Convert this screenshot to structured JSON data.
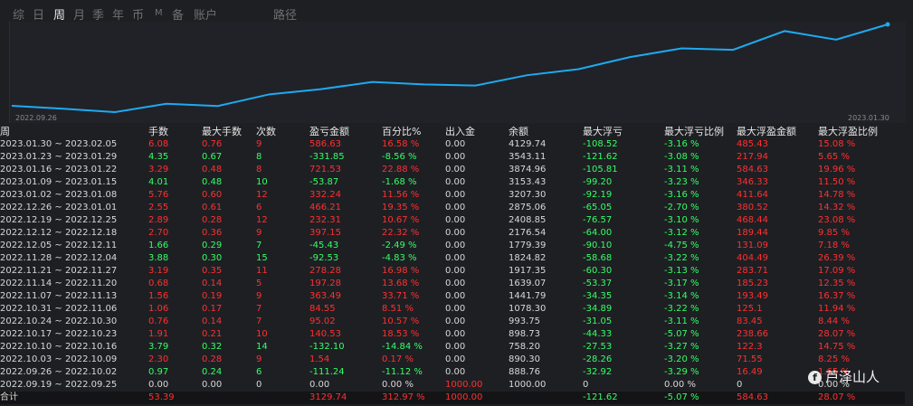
{
  "tabs": [
    "综",
    "日",
    "周",
    "月",
    "季",
    "年",
    "币",
    "M",
    "备",
    "账户",
    "路径"
  ],
  "active_tab": "周",
  "chart_data": {
    "type": "line",
    "x_start_label": "2022.09.26",
    "x_end_label": "2023.01.30",
    "y_values": [
      1000,
      888.76,
      758.2,
      1078.3,
      993.75,
      1441.79,
      1639.07,
      1917.35,
      1824.82,
      1779.39,
      2176.54,
      2408.85,
      2875.06,
      3207.3,
      3153.43,
      3874.96,
      3543.11,
      4129.74
    ],
    "color": "#1eaaf1"
  },
  "table": {
    "headers": [
      "周",
      "手数",
      "最大手数",
      "次数",
      "盈亏金额",
      "百分比%",
      "出入金",
      "余额",
      "最大浮亏",
      "最大浮亏比例",
      "最大浮盈金额",
      "最大浮盈比例"
    ],
    "rows": [
      [
        "2023.01.30 ~ 2023.02.05",
        "6.08",
        "0.76",
        "9",
        "586.63",
        "16.58 %",
        "0.00",
        "4129.74",
        "-108.52",
        "-3.16 %",
        "485.43",
        "15.08 %"
      ],
      [
        "2023.01.23 ~ 2023.01.29",
        "4.35",
        "0.67",
        "8",
        "-331.85",
        "-8.56 %",
        "0.00",
        "3543.11",
        "-121.62",
        "-3.08 %",
        "217.94",
        "5.65 %"
      ],
      [
        "2023.01.16 ~ 2023.01.22",
        "3.29",
        "0.48",
        "8",
        "721.53",
        "22.88 %",
        "0.00",
        "3874.96",
        "-105.81",
        "-3.11 %",
        "584.63",
        "19.96 %"
      ],
      [
        "2023.01.09 ~ 2023.01.15",
        "4.01",
        "0.48",
        "10",
        "-53.87",
        "-1.68 %",
        "0.00",
        "3153.43",
        "-99.20",
        "-3.23 %",
        "346.33",
        "11.50 %"
      ],
      [
        "2023.01.02 ~ 2023.01.08",
        "5.76",
        "0.60",
        "12",
        "332.24",
        "11.56 %",
        "0.00",
        "3207.30",
        "-92.19",
        "-3.16 %",
        "411.64",
        "14.78 %"
      ],
      [
        "2022.12.26 ~ 2023.01.01",
        "2.55",
        "0.61",
        "6",
        "466.21",
        "19.35 %",
        "0.00",
        "2875.06",
        "-65.05",
        "-2.70 %",
        "380.52",
        "14.32 %"
      ],
      [
        "2022.12.19 ~ 2022.12.25",
        "2.89",
        "0.28",
        "12",
        "232.31",
        "10.67 %",
        "0.00",
        "2408.85",
        "-76.57",
        "-3.10 %",
        "468.44",
        "23.08 %"
      ],
      [
        "2022.12.12 ~ 2022.12.18",
        "2.70",
        "0.36",
        "9",
        "397.15",
        "22.32 %",
        "0.00",
        "2176.54",
        "-64.00",
        "-3.12 %",
        "189.44",
        "9.85 %"
      ],
      [
        "2022.12.05 ~ 2022.12.11",
        "1.66",
        "0.29",
        "7",
        "-45.43",
        "-2.49 %",
        "0.00",
        "1779.39",
        "-90.10",
        "-4.75 %",
        "131.09",
        "7.18 %"
      ],
      [
        "2022.11.28 ~ 2022.12.04",
        "3.88",
        "0.30",
        "15",
        "-92.53",
        "-4.83 %",
        "0.00",
        "1824.82",
        "-58.68",
        "-3.22 %",
        "404.49",
        "26.39 %"
      ],
      [
        "2022.11.21 ~ 2022.11.27",
        "3.19",
        "0.35",
        "11",
        "278.28",
        "16.98 %",
        "0.00",
        "1917.35",
        "-60.30",
        "-3.13 %",
        "283.71",
        "17.09 %"
      ],
      [
        "2022.11.14 ~ 2022.11.20",
        "0.68",
        "0.14",
        "5",
        "197.28",
        "13.68 %",
        "0.00",
        "1639.07",
        "-53.37",
        "-3.17 %",
        "185.23",
        "12.35 %"
      ],
      [
        "2022.11.07 ~ 2022.11.13",
        "1.56",
        "0.19",
        "9",
        "363.49",
        "33.71 %",
        "0.00",
        "1441.79",
        "-34.35",
        "-3.14 %",
        "193.49",
        "16.37 %"
      ],
      [
        "2022.10.31 ~ 2022.11.06",
        "1.06",
        "0.17",
        "7",
        "84.55",
        "8.51 %",
        "0.00",
        "1078.30",
        "-34.89",
        "-3.22 %",
        "125.1",
        "11.94 %"
      ],
      [
        "2022.10.24 ~ 2022.10.30",
        "0.76",
        "0.14",
        "7",
        "95.02",
        "10.57 %",
        "0.00",
        "993.75",
        "-31.05",
        "-3.11 %",
        "83.45",
        "8.44 %"
      ],
      [
        "2022.10.17 ~ 2022.10.23",
        "1.91",
        "0.21",
        "10",
        "140.53",
        "18.53 %",
        "0.00",
        "898.73",
        "-44.33",
        "-5.07 %",
        "238.66",
        "28.07 %"
      ],
      [
        "2022.10.10 ~ 2022.10.16",
        "3.79",
        "0.32",
        "14",
        "-132.10",
        "-14.84 %",
        "0.00",
        "758.20",
        "-27.53",
        "-3.27 %",
        "122.3",
        "14.75 %"
      ],
      [
        "2022.10.03 ~ 2022.10.09",
        "2.30",
        "0.28",
        "9",
        "1.54",
        "0.17 %",
        "0.00",
        "890.30",
        "-28.26",
        "-3.20 %",
        "71.55",
        "8.25 %"
      ],
      [
        "2022.09.26 ~ 2022.10.02",
        "0.97",
        "0.24",
        "6",
        "-111.24",
        "-11.12 %",
        "0.00",
        "888.76",
        "-32.92",
        "-3.29 %",
        "16.49",
        "1.65 %"
      ],
      [
        "2022.09.19 ~ 2022.09.25",
        "0.00",
        "0.00",
        "0",
        "0.00",
        "0.00 %",
        "1000.00",
        "1000.00",
        "0",
        "0.00 %",
        "0",
        "0.00 %"
      ]
    ],
    "total": [
      "合计",
      "53.39",
      "",
      "",
      "3129.74",
      "312.97 %",
      "1000.00",
      "",
      "-121.62",
      "-5.07 %",
      "584.63",
      "28.07 %"
    ]
  },
  "colors": {
    "positive": "#ff3030",
    "negative": "#33ff66",
    "line": "#1eaaf1"
  },
  "watermark": "芦泽山人",
  "watermark_icon": "facebook-icon"
}
